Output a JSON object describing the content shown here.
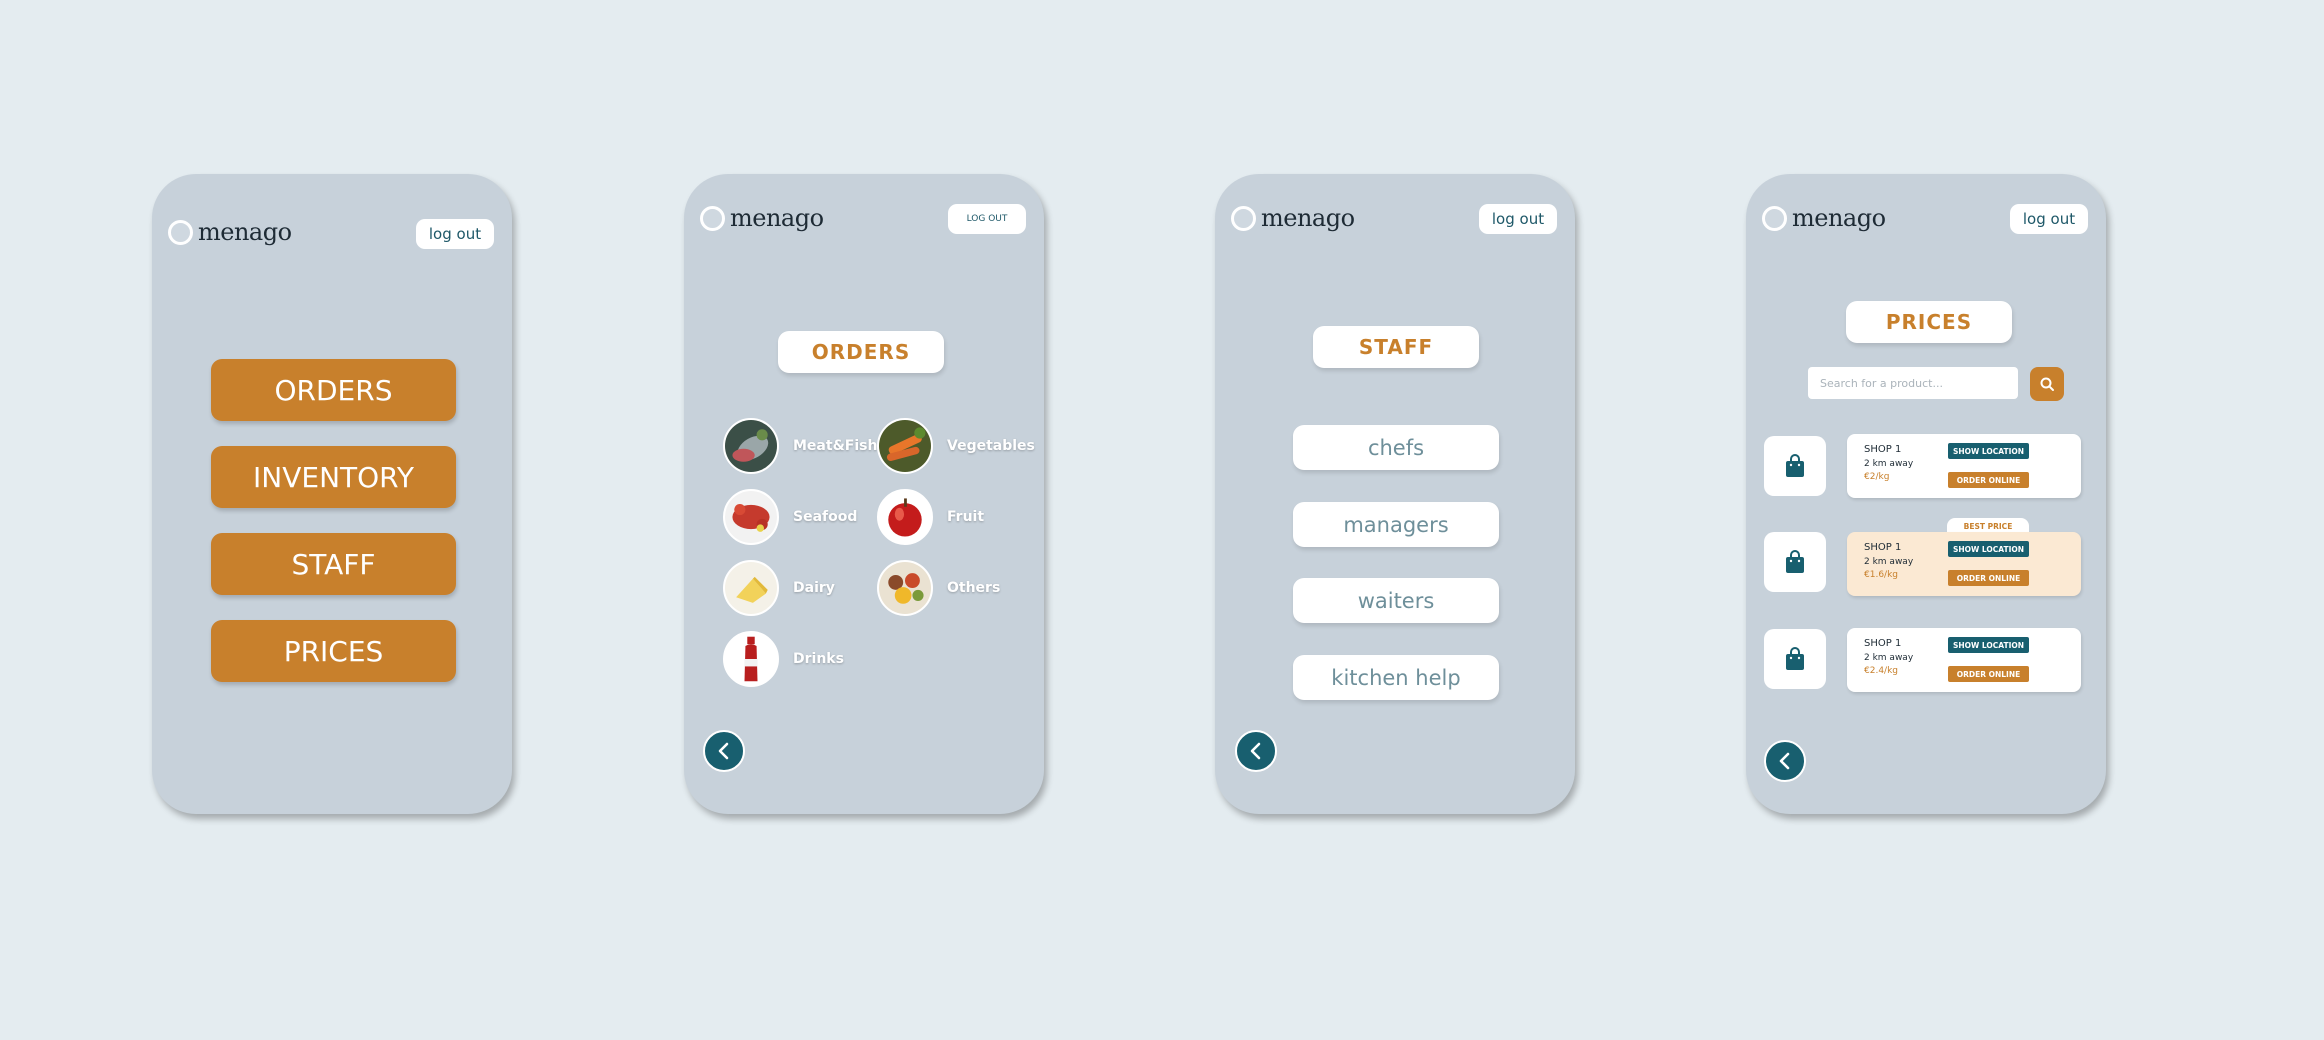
{
  "app": {
    "logo_text": "menago"
  },
  "screens": {
    "home": {
      "logout_label": "log out",
      "menu": [
        "ORDERS",
        "INVENTORY",
        "STAFF",
        "PRICES"
      ]
    },
    "orders": {
      "logout_label": "LOG OUT",
      "title": "ORDERS",
      "categories": [
        "Meat&Fish",
        "Vegetables",
        "Seafood",
        "Fruit",
        "Dairy",
        "Others",
        "Drinks"
      ]
    },
    "staff": {
      "logout_label": "log out",
      "title": "STAFF",
      "items": [
        "chefs",
        "managers",
        "waiters",
        "kitchen help"
      ]
    },
    "prices": {
      "logout_label": "log out",
      "title": "PRICES",
      "search_placeholder": "Search for a product...",
      "best_price_label": "BEST PRICE",
      "show_location_label": "SHOW LOCATION",
      "order_online_label": "ORDER ONLINE",
      "shops": [
        {
          "name": "SHOP 1",
          "distance": "2 km away",
          "price": "€2/kg"
        },
        {
          "name": "SHOP 1",
          "distance": "2 km away",
          "price": "€1.6/kg"
        },
        {
          "name": "SHOP 1",
          "distance": "2 km away",
          "price": "€2.4/kg"
        }
      ]
    }
  },
  "colors": {
    "accent": "#c8802c",
    "teal": "#185f6f",
    "phone": "#c7d1da",
    "background": "#e4ecf0"
  }
}
